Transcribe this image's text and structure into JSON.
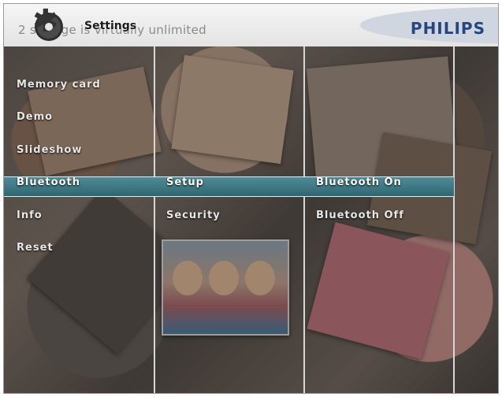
{
  "header": {
    "title": "Settings",
    "subtitle": "2 storage is virtually unlimited",
    "brand": "PHILIPS"
  },
  "menu_col1": {
    "items": [
      {
        "label": "Memory card"
      },
      {
        "label": "Demo"
      },
      {
        "label": "Slideshow"
      },
      {
        "label": "Bluetooth"
      },
      {
        "label": "Info"
      },
      {
        "label": "Reset"
      }
    ],
    "selected": "Bluetooth"
  },
  "menu_col2": {
    "items": [
      {
        "label": "Setup"
      },
      {
        "label": "Security"
      }
    ],
    "selected": "Setup"
  },
  "menu_col3": {
    "items": [
      {
        "label": "Bluetooth On"
      },
      {
        "label": "Bluetooth Off"
      }
    ],
    "selected": "Bluetooth On"
  },
  "colors": {
    "selection": "#3a7783",
    "brand": "#26477d"
  },
  "icons": [
    "gear-icon"
  ]
}
